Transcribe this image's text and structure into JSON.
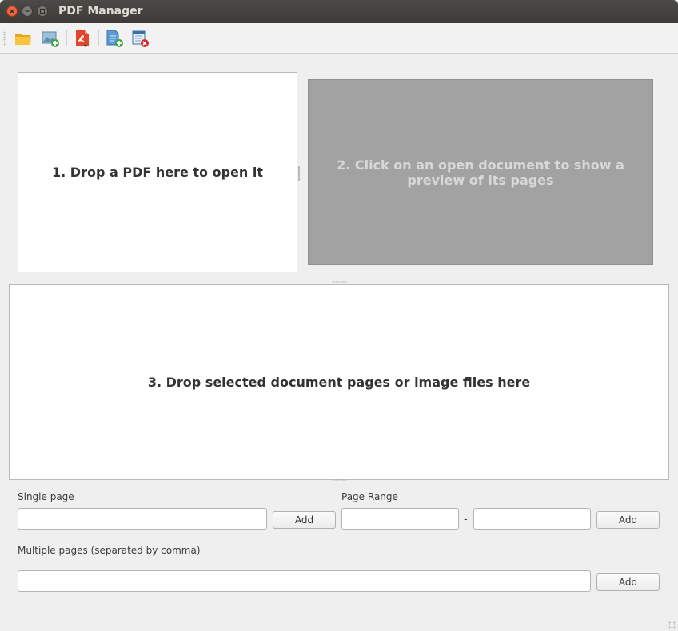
{
  "window": {
    "title": "PDF Manager"
  },
  "toolbar": {
    "items": [
      {
        "icon": "open-folder-icon"
      },
      {
        "icon": "add-image-icon"
      },
      {
        "icon": "export-pdf-icon"
      },
      {
        "icon": "add-page-icon"
      },
      {
        "icon": "remove-page-icon"
      }
    ]
  },
  "panels": {
    "open_drop": "1. Drop a PDF here to open it",
    "preview": "2. Click on an open document to show a preview of its pages",
    "pages_drop": "3. Drop selected document pages or image files here"
  },
  "form": {
    "single_page": {
      "label": "Single page",
      "value": "",
      "add": "Add"
    },
    "page_range": {
      "label": "Page Range",
      "from": "",
      "separator": "-",
      "to": "",
      "add": "Add"
    },
    "multiple_pages": {
      "label": "Multiple pages (separated by comma)",
      "value": "",
      "add": "Add"
    }
  },
  "colors": {
    "titlebar": "#3c3b37",
    "close_button": "#e05a30",
    "preview_background": "#a2a2a2",
    "window_background": "#efefef"
  }
}
